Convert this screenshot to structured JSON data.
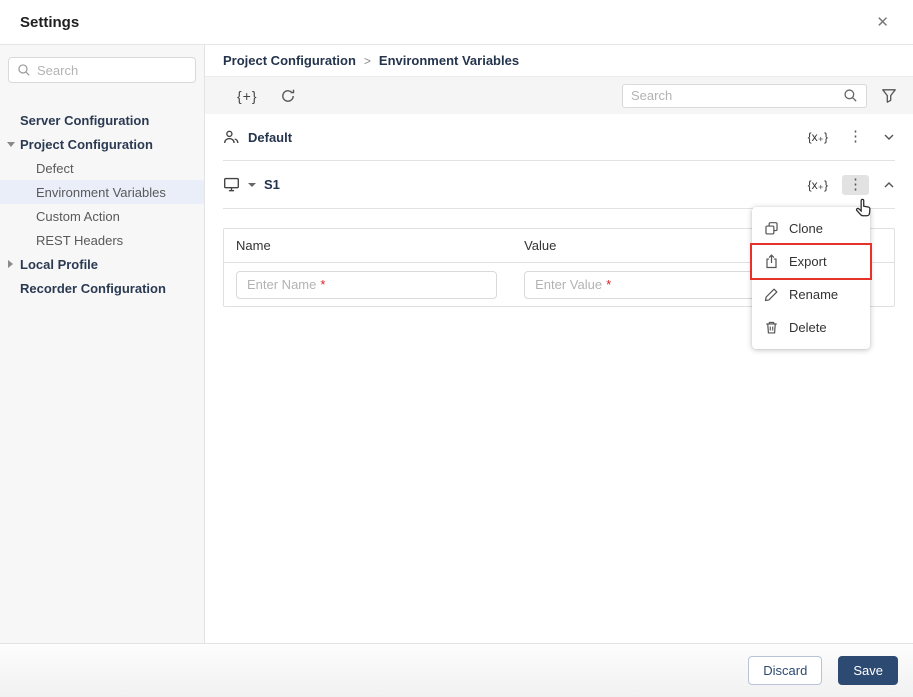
{
  "window": {
    "title": "Settings",
    "close_icon": "✕"
  },
  "sidebar": {
    "search_placeholder": "Search",
    "items": [
      {
        "label": "Server Configuration"
      },
      {
        "label": "Project Configuration"
      },
      {
        "label": "Defect"
      },
      {
        "label": "Environment Variables"
      },
      {
        "label": "Custom Action"
      },
      {
        "label": "REST Headers"
      },
      {
        "label": "Local Profile"
      },
      {
        "label": "Recorder Configuration"
      }
    ],
    "selected_item": "Environment Variables"
  },
  "breadcrumb": {
    "parent": "Project Configuration",
    "separator": ">",
    "current": "Environment Variables"
  },
  "toolbar": {
    "add_variable_icon": "{+}",
    "search_placeholder": "Search"
  },
  "sections": {
    "default": {
      "name": "Default",
      "variable_icon": "{x₊}",
      "kebab_icon": "⋮"
    },
    "s1": {
      "name": "S1",
      "variable_icon": "{x₊}",
      "kebab_icon": "⋮"
    }
  },
  "table": {
    "columns": {
      "name": "Name",
      "value": "Value"
    },
    "name_placeholder": "Enter Name",
    "value_placeholder": "Enter Value",
    "required_marker": "*"
  },
  "context_menu": {
    "items": [
      {
        "label": "Clone"
      },
      {
        "label": "Export"
      },
      {
        "label": "Rename"
      },
      {
        "label": "Delete"
      }
    ],
    "highlighted_item": "Export"
  },
  "footer": {
    "discard_label": "Discard",
    "save_label": "Save"
  },
  "colors": {
    "primary_navy": "#2d4a72",
    "selected_item_bg": "#e9eef9",
    "highlight_red": "#e5332a",
    "required_red": "#e02020",
    "toolbar_bg": "#f5f5f5",
    "sidebar_bg": "#f7f7f7"
  }
}
